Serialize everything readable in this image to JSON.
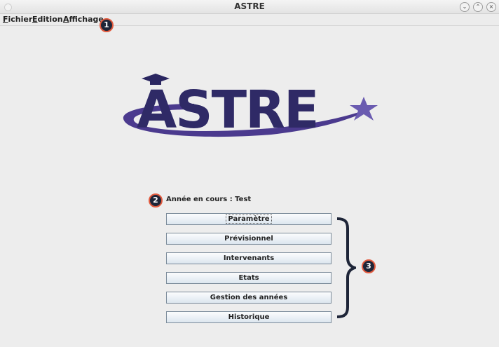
{
  "window": {
    "title": "ASTRE"
  },
  "menu": [
    {
      "mnemonic": "F",
      "rest": "ichier"
    },
    {
      "mnemonic": "E",
      "rest": "dition"
    },
    {
      "mnemonic": "A",
      "rest": "ffichage"
    }
  ],
  "logo": {
    "text": "ASTRE",
    "colors": {
      "primary": "#2f2a66",
      "swoosh": "#5a3f9e"
    }
  },
  "year_label": "Année en cours : Test",
  "buttons": [
    {
      "label": "Paramètre"
    },
    {
      "label": "Prévisionnel"
    },
    {
      "label": "Intervenants"
    },
    {
      "label": "Etats"
    },
    {
      "label": "Gestion des années"
    },
    {
      "label": "Historique"
    }
  ],
  "callouts": [
    "1",
    "2",
    "3"
  ]
}
